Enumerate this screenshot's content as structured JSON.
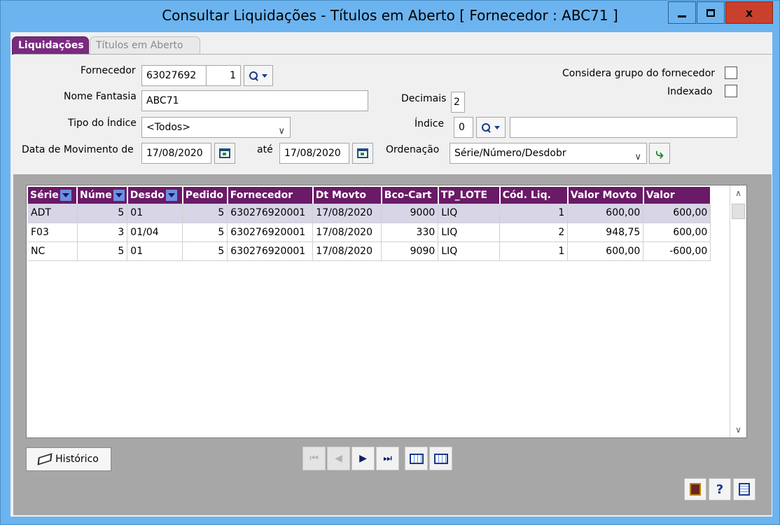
{
  "window": {
    "title": "Consultar Liquidações - Títulos em Aberto [ Fornecedor : ABC71 ]",
    "close_label": "x"
  },
  "tabs": [
    {
      "label": "Liquidações",
      "active": true
    },
    {
      "label": "Títulos em Aberto",
      "active": false
    }
  ],
  "form": {
    "fornecedor_label": "Fornecedor",
    "fornecedor_code": "63027692",
    "fornecedor_seq": "1",
    "nome_fantasia_label": "Nome Fantasia",
    "nome_fantasia_value": "ABC71",
    "tipo_indice_label": "Tipo do Índice",
    "tipo_indice_value": "<Todos>",
    "data_mov_label": "Data de Movimento de",
    "data_de": "17/08/2020",
    "ate_label": "até",
    "data_ate": "17/08/2020",
    "decimais_label": "Decimais",
    "decimais_value": "2",
    "indice_label": "Índice",
    "indice_value": "0",
    "indice_desc": "",
    "ordenacao_label": "Ordenação",
    "ordenacao_value": "Série/Número/Desdobr",
    "considera_grupo_label": "Considera grupo do fornecedor",
    "considera_grupo_checked": false,
    "indexado_label": "Indexado",
    "indexado_checked": false
  },
  "grid": {
    "columns": [
      "Série",
      "Núme",
      "Desdo",
      "Pedido",
      "Fornecedor",
      "Dt Movto",
      "Bco-Cart",
      "TP_LOTE",
      "Cód. Liq.",
      "Valor Movto",
      "Valor"
    ],
    "rows": [
      {
        "serie": "ADT",
        "numero": "5",
        "desdobr": "01",
        "pedido": "5",
        "fornecedor": "630276920001",
        "dt_movto": "17/08/2020",
        "bco_cart": "9000",
        "tp_lote": "LIQ",
        "cod_liq": "1",
        "valor_movto": "600,00",
        "valor": "600,00"
      },
      {
        "serie": "F03",
        "numero": "3",
        "desdobr": "01/04",
        "pedido": "5",
        "fornecedor": "630276920001",
        "dt_movto": "17/08/2020",
        "bco_cart": "330",
        "tp_lote": "LIQ",
        "cod_liq": "2",
        "valor_movto": "948,75",
        "valor": "600,00"
      },
      {
        "serie": "NC",
        "numero": "5",
        "desdobr": "01",
        "pedido": "5",
        "fornecedor": "630276920001",
        "dt_movto": "17/08/2020",
        "bco_cart": "9090",
        "tp_lote": "LIQ",
        "cod_liq": "1",
        "valor_movto": "600,00",
        "valor": "-600,00"
      }
    ]
  },
  "buttons": {
    "historico_label": "Histórico",
    "help_label": "?"
  },
  "colors": {
    "titlebar": "#6cb4f0",
    "tab_active": "#7a2a80",
    "grid_header": "#6a1a66",
    "selected_row": "#d7d5e6"
  }
}
